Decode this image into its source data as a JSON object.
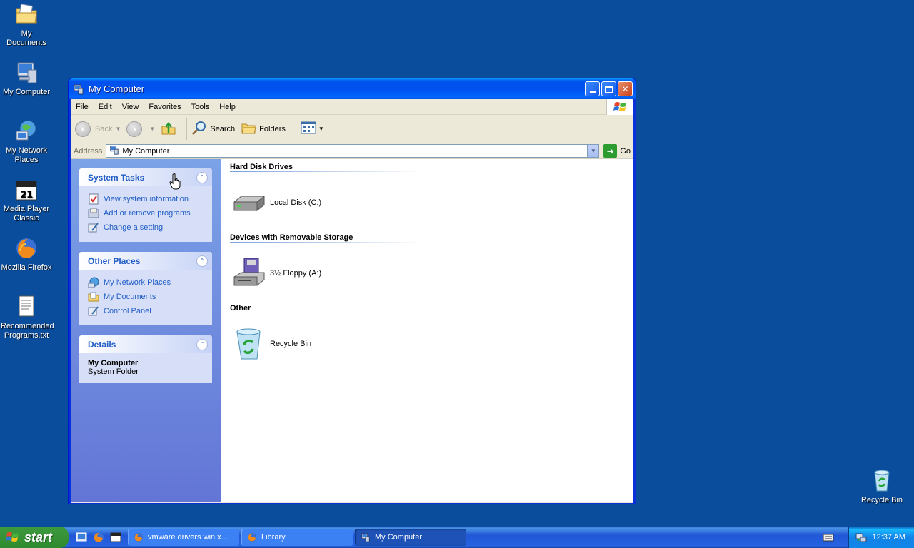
{
  "desktop": {
    "icons": [
      {
        "label": "My Documents"
      },
      {
        "label": "My Computer"
      },
      {
        "label": "My Network Places"
      },
      {
        "label": "Media Player Classic"
      },
      {
        "label": "Mozilla Firefox"
      },
      {
        "label": "Recommended Programs.txt"
      }
    ],
    "recycle_bin_label": "Recycle Bin"
  },
  "window": {
    "title": "My Computer",
    "menu": [
      "File",
      "Edit",
      "View",
      "Favorites",
      "Tools",
      "Help"
    ],
    "toolbar": {
      "back": "Back",
      "search": "Search",
      "folders": "Folders"
    },
    "address": {
      "label": "Address",
      "value": "My Computer",
      "go": "Go"
    },
    "left_pane": {
      "system_tasks": {
        "title": "System Tasks",
        "links": [
          "View system information",
          "Add or remove programs",
          "Change a setting"
        ]
      },
      "other_places": {
        "title": "Other Places",
        "links": [
          "My Network Places",
          "My Documents",
          "Control Panel"
        ]
      },
      "details": {
        "title": "Details",
        "name": "My Computer",
        "type": "System Folder"
      }
    },
    "content": {
      "groups": [
        {
          "heading": "Hard Disk Drives",
          "item": "Local Disk (C:)"
        },
        {
          "heading": "Devices with Removable Storage",
          "item": "3½ Floppy (A:)"
        },
        {
          "heading": "Other",
          "item": "Recycle Bin"
        }
      ]
    }
  },
  "taskbar": {
    "start": "start",
    "tasks": [
      {
        "label": "vmware drivers win x..."
      },
      {
        "label": "Library"
      },
      {
        "label": "My Computer"
      }
    ],
    "clock": "12:37 AM"
  },
  "colors": {
    "desktop": "#0a4d9c",
    "link": "#215dc6",
    "titlebar": "#0053ee"
  }
}
